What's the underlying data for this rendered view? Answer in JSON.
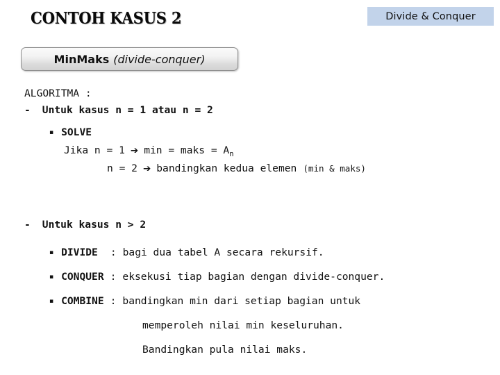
{
  "corner_badge": {
    "label": "Divide & Conquer",
    "bg_color": "#c2d3ea",
    "text_color": "#101010"
  },
  "title": {
    "text": "CONTOH KASUS 2"
  },
  "subtitle": {
    "bold_part": "MinMaks",
    "italic_part": "(divide-conquer)"
  },
  "body": {
    "heading": "ALGORITMA :",
    "case_small": {
      "dash": "-",
      "label": "Untuk kasus n = 1 atau n = 2",
      "bullet": "▪",
      "solve_label": "SOLVE",
      "jika_prefix": "Jika n = 1",
      "arrow": "➔",
      "jika_result": "min = maks = A",
      "jika_result_sub": "n",
      "n2_prefix": "n = 2",
      "n2_result": "bandingkan kedua elemen",
      "n2_note": "(min & maks)"
    },
    "case_large": {
      "dash": "-",
      "label": "Untuk kasus n > 2",
      "bullet": "▪",
      "steps": [
        {
          "name": "DIVIDE",
          "sep": ":",
          "desc": "bagi dua tabel A secara rekursif."
        },
        {
          "name": "CONQUER",
          "sep": ":",
          "desc": "eksekusi tiap bagian dengan divide-conquer."
        },
        {
          "name": "COMBINE",
          "sep": ":",
          "desc": "bandingkan min dari setiap bagian untuk"
        }
      ],
      "combine_cont_1": "memperoleh nilai min keseluruhan.",
      "combine_cont_2": "Bandingkan pula nilai maks."
    }
  }
}
